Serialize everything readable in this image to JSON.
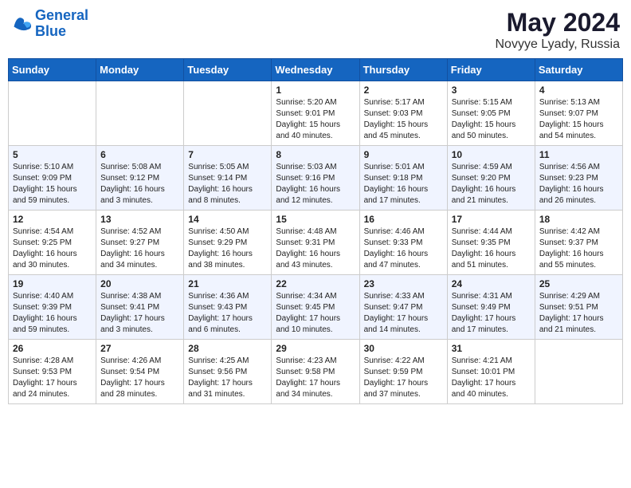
{
  "header": {
    "logo_line1": "General",
    "logo_line2": "Blue",
    "month": "May 2024",
    "location": "Novyye Lyady, Russia"
  },
  "days_of_week": [
    "Sunday",
    "Monday",
    "Tuesday",
    "Wednesday",
    "Thursday",
    "Friday",
    "Saturday"
  ],
  "weeks": [
    [
      {
        "day": "",
        "info": ""
      },
      {
        "day": "",
        "info": ""
      },
      {
        "day": "",
        "info": ""
      },
      {
        "day": "1",
        "info": "Sunrise: 5:20 AM\nSunset: 9:01 PM\nDaylight: 15 hours and 40 minutes."
      },
      {
        "day": "2",
        "info": "Sunrise: 5:17 AM\nSunset: 9:03 PM\nDaylight: 15 hours and 45 minutes."
      },
      {
        "day": "3",
        "info": "Sunrise: 5:15 AM\nSunset: 9:05 PM\nDaylight: 15 hours and 50 minutes."
      },
      {
        "day": "4",
        "info": "Sunrise: 5:13 AM\nSunset: 9:07 PM\nDaylight: 15 hours and 54 minutes."
      }
    ],
    [
      {
        "day": "5",
        "info": "Sunrise: 5:10 AM\nSunset: 9:09 PM\nDaylight: 15 hours and 59 minutes."
      },
      {
        "day": "6",
        "info": "Sunrise: 5:08 AM\nSunset: 9:12 PM\nDaylight: 16 hours and 3 minutes."
      },
      {
        "day": "7",
        "info": "Sunrise: 5:05 AM\nSunset: 9:14 PM\nDaylight: 16 hours and 8 minutes."
      },
      {
        "day": "8",
        "info": "Sunrise: 5:03 AM\nSunset: 9:16 PM\nDaylight: 16 hours and 12 minutes."
      },
      {
        "day": "9",
        "info": "Sunrise: 5:01 AM\nSunset: 9:18 PM\nDaylight: 16 hours and 17 minutes."
      },
      {
        "day": "10",
        "info": "Sunrise: 4:59 AM\nSunset: 9:20 PM\nDaylight: 16 hours and 21 minutes."
      },
      {
        "day": "11",
        "info": "Sunrise: 4:56 AM\nSunset: 9:23 PM\nDaylight: 16 hours and 26 minutes."
      }
    ],
    [
      {
        "day": "12",
        "info": "Sunrise: 4:54 AM\nSunset: 9:25 PM\nDaylight: 16 hours and 30 minutes."
      },
      {
        "day": "13",
        "info": "Sunrise: 4:52 AM\nSunset: 9:27 PM\nDaylight: 16 hours and 34 minutes."
      },
      {
        "day": "14",
        "info": "Sunrise: 4:50 AM\nSunset: 9:29 PM\nDaylight: 16 hours and 38 minutes."
      },
      {
        "day": "15",
        "info": "Sunrise: 4:48 AM\nSunset: 9:31 PM\nDaylight: 16 hours and 43 minutes."
      },
      {
        "day": "16",
        "info": "Sunrise: 4:46 AM\nSunset: 9:33 PM\nDaylight: 16 hours and 47 minutes."
      },
      {
        "day": "17",
        "info": "Sunrise: 4:44 AM\nSunset: 9:35 PM\nDaylight: 16 hours and 51 minutes."
      },
      {
        "day": "18",
        "info": "Sunrise: 4:42 AM\nSunset: 9:37 PM\nDaylight: 16 hours and 55 minutes."
      }
    ],
    [
      {
        "day": "19",
        "info": "Sunrise: 4:40 AM\nSunset: 9:39 PM\nDaylight: 16 hours and 59 minutes."
      },
      {
        "day": "20",
        "info": "Sunrise: 4:38 AM\nSunset: 9:41 PM\nDaylight: 17 hours and 3 minutes."
      },
      {
        "day": "21",
        "info": "Sunrise: 4:36 AM\nSunset: 9:43 PM\nDaylight: 17 hours and 6 minutes."
      },
      {
        "day": "22",
        "info": "Sunrise: 4:34 AM\nSunset: 9:45 PM\nDaylight: 17 hours and 10 minutes."
      },
      {
        "day": "23",
        "info": "Sunrise: 4:33 AM\nSunset: 9:47 PM\nDaylight: 17 hours and 14 minutes."
      },
      {
        "day": "24",
        "info": "Sunrise: 4:31 AM\nSunset: 9:49 PM\nDaylight: 17 hours and 17 minutes."
      },
      {
        "day": "25",
        "info": "Sunrise: 4:29 AM\nSunset: 9:51 PM\nDaylight: 17 hours and 21 minutes."
      }
    ],
    [
      {
        "day": "26",
        "info": "Sunrise: 4:28 AM\nSunset: 9:53 PM\nDaylight: 17 hours and 24 minutes."
      },
      {
        "day": "27",
        "info": "Sunrise: 4:26 AM\nSunset: 9:54 PM\nDaylight: 17 hours and 28 minutes."
      },
      {
        "day": "28",
        "info": "Sunrise: 4:25 AM\nSunset: 9:56 PM\nDaylight: 17 hours and 31 minutes."
      },
      {
        "day": "29",
        "info": "Sunrise: 4:23 AM\nSunset: 9:58 PM\nDaylight: 17 hours and 34 minutes."
      },
      {
        "day": "30",
        "info": "Sunrise: 4:22 AM\nSunset: 9:59 PM\nDaylight: 17 hours and 37 minutes."
      },
      {
        "day": "31",
        "info": "Sunrise: 4:21 AM\nSunset: 10:01 PM\nDaylight: 17 hours and 40 minutes."
      },
      {
        "day": "",
        "info": ""
      }
    ]
  ]
}
